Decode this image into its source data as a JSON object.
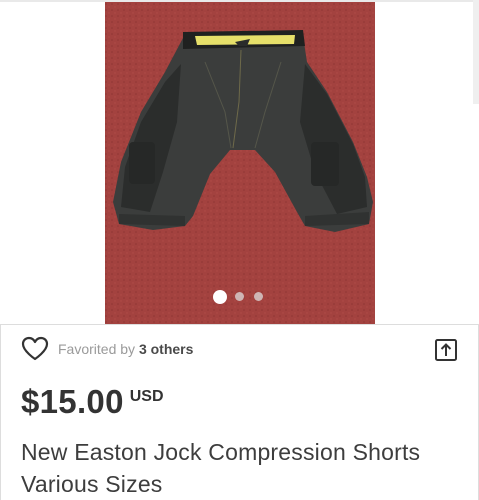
{
  "gallery": {
    "image_alt": "Easton compression shorts photo",
    "dots": {
      "total": 3,
      "active_index": 0
    }
  },
  "favorites": {
    "prefix": "Favorited by ",
    "count_label": "3 others",
    "icons": {
      "favorite": "heart-outline-icon",
      "share": "share-up-arrow-icon"
    }
  },
  "listing": {
    "price": "$15.00",
    "currency": "USD",
    "title_line1": "New Easton Jock Compression Shorts",
    "title_line2": "Various Sizes"
  },
  "colors": {
    "carpet": "#a3423f",
    "shorts": "#3b3d3c",
    "waistband": "#e6e06a",
    "text_dark": "#333333",
    "text_muted": "#9a9a9a"
  }
}
